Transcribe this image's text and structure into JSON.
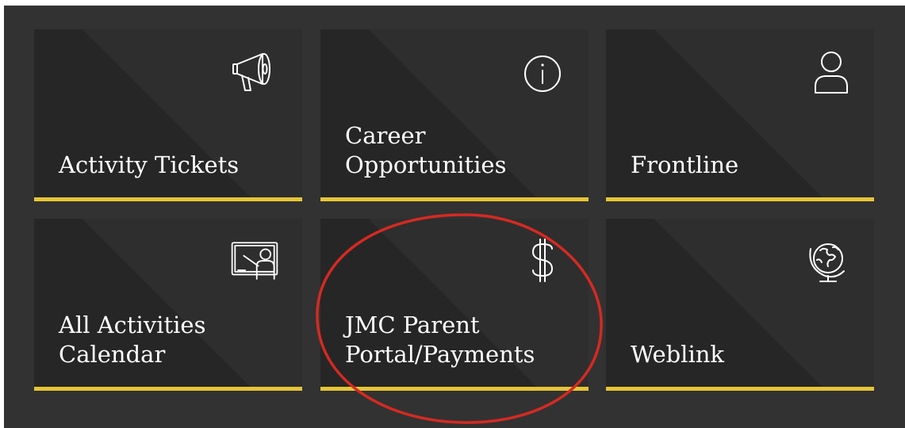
{
  "tiles": [
    {
      "label": "Activity Tickets",
      "icon": "megaphone-icon"
    },
    {
      "label": "Career\nOpportunities",
      "icon": "info-icon"
    },
    {
      "label": "Frontline",
      "icon": "user-icon"
    },
    {
      "label": "All Activities\nCalendar",
      "icon": "teacher-board-icon"
    },
    {
      "label": "JMC Parent\nPortal/Payments",
      "icon": "dollar-icon"
    },
    {
      "label": "Weblink",
      "icon": "globe-icon"
    }
  ],
  "colors": {
    "background": "#323232",
    "tile": "#262626",
    "accent_bar": "#e6c536",
    "highlight_circle": "#d42a22"
  }
}
